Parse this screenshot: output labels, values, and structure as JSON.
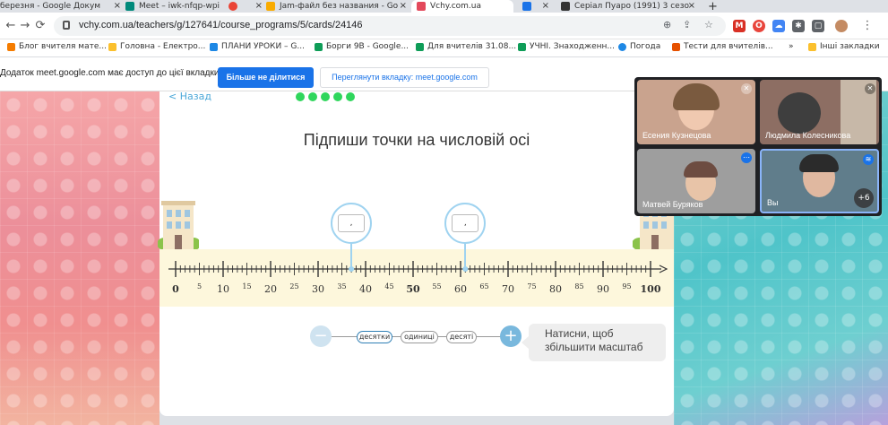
{
  "tabs": [
    {
      "title": "березня - Google Докум",
      "favicon_color": "#4285f4"
    },
    {
      "title": "Meet – iwk-nfqp-wpi",
      "favicon_color": "#00897b"
    },
    {
      "title": "",
      "favicon_color": "#ea4335"
    },
    {
      "title": "Jam-файл без названия - Go",
      "favicon_color": "#f9ab00"
    },
    {
      "title": "Vchy.com.ua",
      "favicon_color": "#e3495b"
    },
    {
      "title": "",
      "favicon_color": "#1a73e8"
    },
    {
      "title": "Серіал Пуаро (1991) 3 сезо",
      "favicon_color": "#333333"
    }
  ],
  "tab_close": "×",
  "new_tab": "+",
  "nav": {
    "back": "←",
    "forward": "→",
    "reload": "⟳",
    "home": "⌂"
  },
  "address": {
    "url": "vchy.com.ua/teachers/g/127641/course_programs/5/cards/24146"
  },
  "omnibox_icons": {
    "zoom": "⊕",
    "share": "⇪",
    "star": "☆"
  },
  "extensions": [
    {
      "label": "M",
      "color": "#d93025"
    },
    {
      "label": "O",
      "color": "#e8453c"
    },
    {
      "label": "☁",
      "color": "#4285f4"
    },
    {
      "label": "✱",
      "color": "#5f6368"
    },
    {
      "label": "▢",
      "color": "#5f6368"
    }
  ],
  "menu": "⋮",
  "bookmarks": [
    {
      "label": "Блог вчителя мате...",
      "color": "#f57c00"
    },
    {
      "label": "Головна - Електро...",
      "color": "#fbc02d"
    },
    {
      "label": "ПЛАНИ УРОКИ – G...",
      "color": "#1e88e5"
    },
    {
      "label": "Борги 9В - Google...",
      "color": "#0f9d58"
    },
    {
      "label": "Для вчителів 31.08...",
      "color": "#0f9d58"
    },
    {
      "label": "УЧНІ. Знаходженн...",
      "color": "#0f9d58"
    },
    {
      "label": "Погода",
      "color": "#1e88e5"
    },
    {
      "label": "Тести для вчителів...",
      "color": "#e65100"
    }
  ],
  "bookmarks_more": "»",
  "other_bookmarks": "Інші закладки",
  "share_bar": {
    "message": "Додаток meet.google.com має доступ до цієї вкладки",
    "stop": "Більше не ділитися",
    "switch": "Переглянути вкладку: meet.google.com"
  },
  "lesson": {
    "back_label": "< Назад",
    "title": "Підпиши точки на числовій осі",
    "progress_completed": 5,
    "number_line": {
      "min": 0,
      "max": 100,
      "major_step": 10,
      "minor_step": 1,
      "labels": [
        "0",
        "5",
        "10",
        "15",
        "20",
        "25",
        "30",
        "35",
        "40",
        "45",
        "50",
        "55",
        "60",
        "65",
        "70",
        "75",
        "80",
        "85",
        "90",
        "95",
        "100"
      ],
      "bold_labels": [
        "0",
        "50",
        "100"
      ]
    },
    "points": [
      {
        "value": 37,
        "input": ","
      },
      {
        "value": 61,
        "input": ","
      }
    ],
    "controls": {
      "minus": "−",
      "plus": "+",
      "levels": [
        "десятки",
        "одиниці",
        "десяті"
      ],
      "selected_level": "десятки",
      "hint": [
        "Натисни, щоб",
        "збільшити масштаб"
      ]
    }
  },
  "meet": {
    "participants": [
      {
        "name": "Есения Кузнецова",
        "bg": "#c9a38e",
        "muted": true
      },
      {
        "name": "Людмила Колесникова",
        "bg": "#8d6e63",
        "muted": true
      },
      {
        "name": "Матвей Буряков",
        "bg": "#9e9e9e",
        "muted": false
      },
      {
        "name": "Вы",
        "bg": "#607d8b",
        "muted": false
      }
    ],
    "more_count": "+6"
  }
}
